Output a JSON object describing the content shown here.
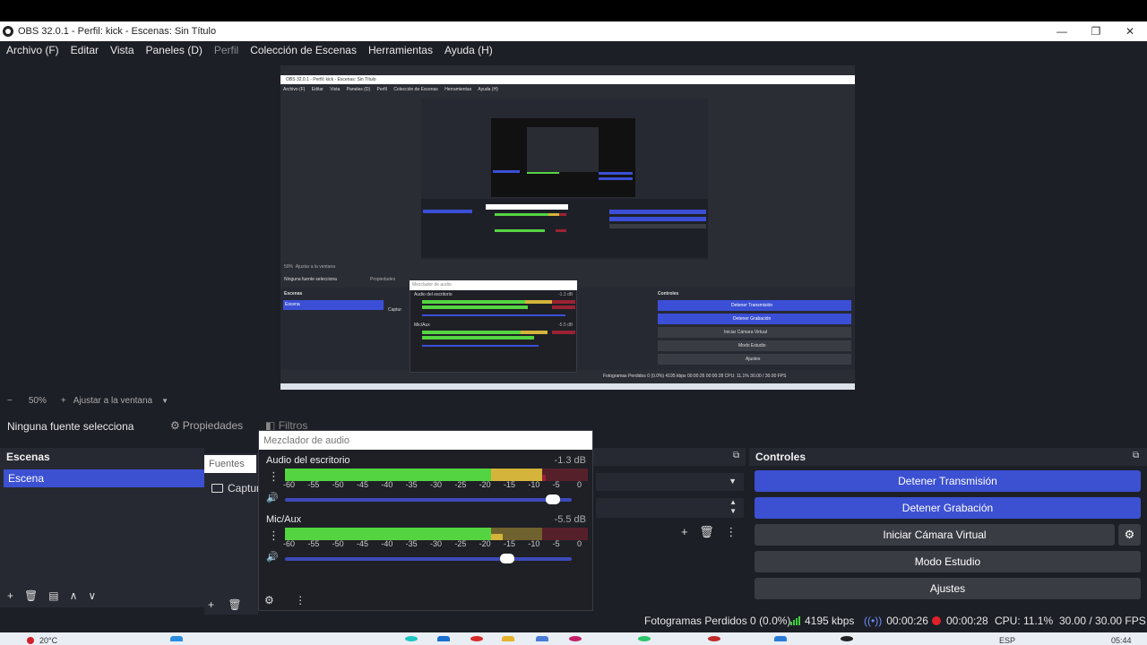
{
  "window": {
    "title": "OBS 32.0.1 - Perfil: kick - Escenas: Sin Título",
    "minimize": "—",
    "maximize": "❐",
    "close": "✕"
  },
  "menu": {
    "items": [
      "Archivo (F)",
      "Editar",
      "Vista",
      "Paneles (D)",
      "Perfil",
      "Colección de Escenas",
      "Herramientas",
      "Ayuda (H)"
    ]
  },
  "preview": {
    "nested_title": "OBS 32.0.1 - Perfil: kick - Escenas: Sin Título",
    "nested_menu": [
      "Archivo (F)",
      "Editar",
      "Vista",
      "Paneles (D)",
      "Perfil",
      "Colección de Escenas",
      "Herramientas",
      "Ayuda (H)"
    ],
    "nested_no_source": "Ninguna fuente selecciona",
    "nested_properties": "Propiedades",
    "nested_scenes": "Escenas",
    "nested_scene": "Escena",
    "nested_mixer": "Mezclador de audio",
    "nested_desktop": "Audio del escritorio",
    "nested_desktop_db": "-1.3 dB",
    "nested_mic": "Mic/Aux",
    "nested_mic_db": "-5.5 dB",
    "nested_controls": "Controles",
    "nested_stop_stream": "Detener Transmisión",
    "nested_stop_rec": "Detener Grabación",
    "nested_virtual_cam": "Iniciar Cámara Virtual",
    "nested_studio": "Modo Estudio",
    "nested_settings": "Ajustes",
    "nested_status": "Fotogramas Perdidos 0 (0.0%)   4195 kbps   00:00:26   00:00:28   CPU: 11.1%   30.00 / 30.00 FPS",
    "nested_capture": "Captur",
    "nested_fit": "Ajustar a la ventana",
    "nested_zoom": "50%"
  },
  "zoom": {
    "minus": "−",
    "value": "50%",
    "plus": "+",
    "fit": "Ajustar a la ventana",
    "caret": "▼"
  },
  "source_bar": {
    "no_selection": "Ninguna fuente selecciona",
    "properties": "Propiedades",
    "filters": "Filtros"
  },
  "scenes": {
    "title": "Escenas",
    "items": [
      "Escena"
    ],
    "tools": [
      "+",
      "🗑",
      "▤",
      "∧",
      "∨"
    ]
  },
  "sources": {
    "tab": "Fuentes",
    "items": [
      "Captur"
    ],
    "tools": [
      "+",
      "🗑"
    ]
  },
  "mixer": {
    "title": "Mezclador de audio",
    "channels": [
      {
        "name": "Audio del escritorio",
        "db": "-1.3 dB",
        "level_top": 0.85,
        "level_bottom": 0.86,
        "volume": 0.96
      },
      {
        "name": "Mic/Aux",
        "db": "-5.5 dB",
        "level_top": 0.68,
        "level_bottom": 0.72,
        "volume": 0.8
      }
    ],
    "ticks": [
      "-60",
      "-55",
      "-50",
      "-45",
      "-40",
      "-35",
      "-30",
      "-25",
      "-20",
      "-15",
      "-10",
      "-5",
      "0"
    ]
  },
  "controls": {
    "title": "Controles",
    "stop_stream": "Detener Transmisión",
    "stop_recording": "Detener Grabación",
    "start_virtual_cam": "Iniciar Cámara Virtual",
    "studio_mode": "Modo Estudio",
    "settings": "Ajustes"
  },
  "status": {
    "dropped_frames": "Fotogramas Perdidos 0 (0.0%)",
    "bitrate": "4195 kbps",
    "stream_time": "00:00:26",
    "rec_time": "00:00:28",
    "cpu": "CPU: 11.1%",
    "fps": "30.00 / 30.00 FPS"
  },
  "taskbar": {
    "weather": "20°C",
    "lang": "ESP",
    "clock": "05:44"
  },
  "colors": {
    "accent": "#3c50d2",
    "meter_green": "#55d441",
    "meter_yellow": "#d4b43a",
    "meter_red": "#9b2233",
    "background": "#1d1f26"
  }
}
